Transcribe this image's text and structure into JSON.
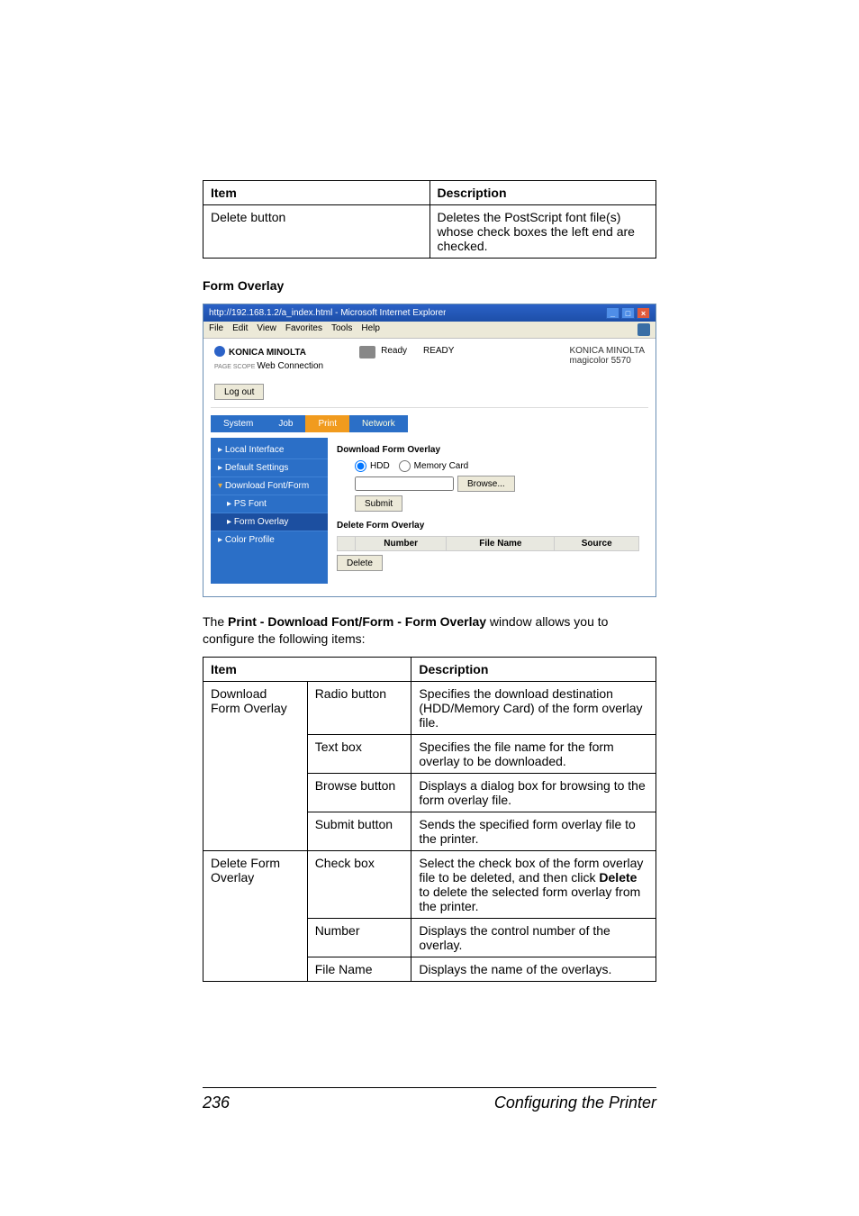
{
  "table1": {
    "headers": [
      "Item",
      "Description"
    ],
    "rows": [
      {
        "item": "Delete button",
        "desc": "Deletes the PostScript font file(s) whose check boxes the left end are checked."
      }
    ]
  },
  "section_title": "Form Overlay",
  "browser": {
    "title": "http://192.168.1.2/a_index.html - Microsoft Internet Explorer",
    "menus": [
      "File",
      "Edit",
      "View",
      "Favorites",
      "Tools",
      "Help"
    ],
    "win_buttons": [
      "_",
      "□",
      "×"
    ],
    "brand": {
      "km": "KONICA MINOLTA",
      "wc_prefix": "PAGE SCOPE ",
      "wc": "Web Connection"
    },
    "ready_label": "Ready",
    "ready_status": "READY",
    "km_right_line1": "KONICA MINOLTA",
    "km_right_line2": "magicolor 5570",
    "logout": "Log out",
    "tabs": [
      "System",
      "Job",
      "Print",
      "Network"
    ],
    "sidebar": [
      {
        "label": "Local Interface",
        "class": "leaf"
      },
      {
        "label": "Default Settings",
        "class": "leaf"
      },
      {
        "label": "Download Font/Form",
        "class": "expand"
      },
      {
        "label": "PS Font",
        "class": "sub leaf"
      },
      {
        "label": "Form Overlay",
        "class": "sub leaf active"
      },
      {
        "label": "Color Profile",
        "class": "leaf"
      }
    ],
    "pane": {
      "h_download": "Download Form Overlay",
      "radio_hdd": "HDD",
      "radio_mc": "Memory Card",
      "browse": "Browse...",
      "submit": "Submit",
      "h_delete": "Delete Form Overlay",
      "cols": [
        "",
        "Number",
        "File Name",
        "Source"
      ],
      "delete": "Delete"
    }
  },
  "paragraph_prefix": "The ",
  "paragraph_bold": "Print - Download Font/Form - Form Overlay",
  "paragraph_suffix": " window allows you to configure the following items:",
  "table2": {
    "headers": [
      "Item",
      "Description"
    ],
    "rows": [
      {
        "group": "Download Form Overlay",
        "sub": "Radio button",
        "desc": "Specifies the download destination (HDD/Memory Card) of the form overlay file."
      },
      {
        "group": "",
        "sub": "Text box",
        "desc": "Specifies the file name for the form overlay to be downloaded."
      },
      {
        "group": "",
        "sub": "Browse button",
        "desc": "Displays a dialog box for browsing to the form overlay file."
      },
      {
        "group": "",
        "sub": "Submit button",
        "desc": "Sends the specified form overlay file to the printer."
      },
      {
        "group": "Delete Form Overlay",
        "sub": "Check box",
        "desc_pre": "Select the check box of the form overlay file to be deleted, and then click ",
        "desc_bold": "Delete",
        "desc_post": " to delete the selected form overlay from the printer."
      },
      {
        "group": "",
        "sub": "Number",
        "desc": "Displays the control number of the overlay."
      },
      {
        "group": "",
        "sub": "File Name",
        "desc": "Displays the name of the overlays."
      }
    ]
  },
  "footer": {
    "page": "236",
    "section": "Configuring the Printer"
  }
}
